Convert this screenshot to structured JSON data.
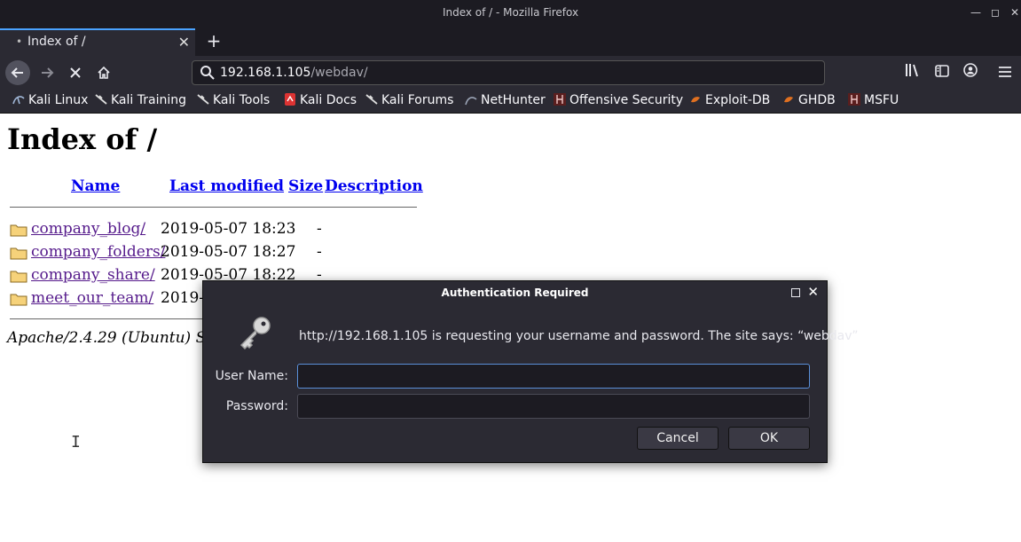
{
  "window": {
    "title": "Index of / - Mozilla Firefox"
  },
  "tab": {
    "label": "Index of /"
  },
  "urlbar": {
    "host": "192.168.1.105",
    "path": "/webdav/"
  },
  "bookmarks": [
    {
      "label": "Kali Linux"
    },
    {
      "label": "Kali Training"
    },
    {
      "label": "Kali Tools"
    },
    {
      "label": "Kali Docs"
    },
    {
      "label": "Kali Forums"
    },
    {
      "label": "NetHunter"
    },
    {
      "label": "Offensive Security"
    },
    {
      "label": "Exploit-DB"
    },
    {
      "label": "GHDB"
    },
    {
      "label": "MSFU"
    }
  ],
  "page": {
    "heading": "Index of /",
    "columns": {
      "name": "Name",
      "modified": "Last modified",
      "size": "Size",
      "description": "Description"
    },
    "rows": [
      {
        "name": "company_blog/",
        "modified": "2019-05-07 18:23",
        "size": "-"
      },
      {
        "name": "company_folders/",
        "modified": "2019-05-07 18:27",
        "size": "-"
      },
      {
        "name": "company_share/",
        "modified": "2019-05-07 18:22",
        "size": "-"
      },
      {
        "name": "meet_our_team/",
        "modified": "2019-05-07 18:23",
        "size": "-"
      }
    ],
    "footer": "Apache/2.4.29 (Ubuntu) Server at 192.168.1.105 Port 80"
  },
  "dialog": {
    "title": "Authentication Required",
    "message": "http://192.168.1.105 is requesting your username and password. The site says: “webdav”",
    "username_label": "User Name:",
    "password_label": "Password:",
    "username_value": "",
    "password_value": "",
    "cancel_label": "Cancel",
    "ok_label": "OK"
  },
  "colors": {
    "chrome_dark": "#1c1b22",
    "chrome": "#2b2a33",
    "link": "#0000ee",
    "visited": "#551a8b",
    "focus": "#5a8fd8"
  }
}
